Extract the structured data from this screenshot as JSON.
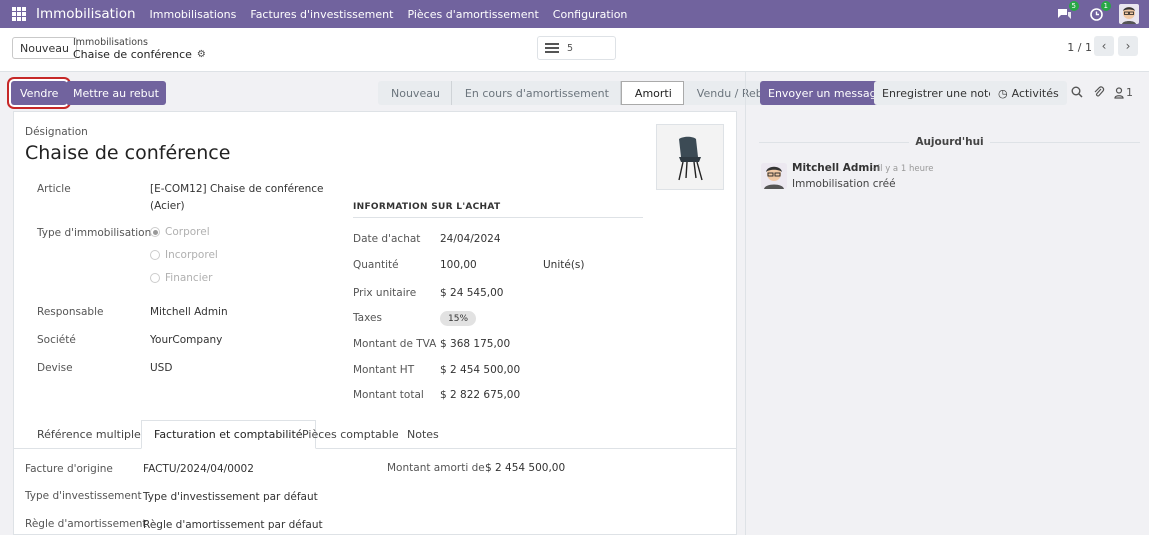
{
  "navbar": {
    "app_name": "Immobilisation",
    "menu": [
      "Immobilisations",
      "Factures d'investissement",
      "Pièces d'amortissement",
      "Configuration"
    ],
    "messages_badge": "5",
    "activities_badge": "1"
  },
  "control": {
    "new_label": "Nouveau",
    "breadcrumb_parent": "Immobilisations",
    "breadcrumb_current": "Chaise de conférence",
    "count": "5",
    "pager": "1 / 1"
  },
  "actions": {
    "sell": "Vendre",
    "scrap": "Mettre au rebut"
  },
  "status": {
    "stages": [
      "Nouveau",
      "En cours d'amortissement",
      "Amorti",
      "Vendu / Rebut"
    ],
    "active": "Amorti"
  },
  "form": {
    "name_label": "Désignation",
    "name": "Chaise de conférence",
    "article_label": "Article",
    "article_line1": "[E-COM12] Chaise de conférence",
    "article_line2": "(Acier)",
    "type_label": "Type d'immobilisation",
    "type_options": [
      "Corporel",
      "Incorporel",
      "Financier"
    ],
    "type_selected": "Corporel",
    "responsible_label": "Responsable",
    "responsible": "Mitchell Admin",
    "company_label": "Société",
    "company": "YourCompany",
    "currency_label": "Devise",
    "currency": "USD",
    "purchase_section": "INFORMATION SUR L'ACHAT",
    "purchase": {
      "date_label": "Date d'achat",
      "date": "24/04/2024",
      "qty_label": "Quantité",
      "qty": "100,00",
      "uom": "Unité(s)",
      "unit_price_label": "Prix unitaire",
      "unit_price": "$ 24 545,00",
      "taxes_label": "Taxes",
      "taxes": "15%",
      "vat_label": "Montant de TVA",
      "vat": "$ 368 175,00",
      "untaxed_label": "Montant HT",
      "untaxed": "$ 2 454 500,00",
      "total_label": "Montant total",
      "total": "$ 2 822 675,00"
    },
    "tabs": [
      "Référence multiples",
      "Facturation et comptabilité",
      "Pièces comptable",
      "Notes"
    ],
    "active_tab": "Facturation et comptabilité",
    "billing": {
      "origin_label": "Facture d'origine",
      "origin": "FACTU/2024/04/0002",
      "depreciated_label": "Montant amorti de",
      "depreciated": "$ 2 454 500,00",
      "inv_type_label": "Type d'investissement",
      "inv_type": "Type d'investissement par défaut",
      "dep_rule_label": "Règle d'amortissement",
      "dep_rule": "Règle d'amortissement par défaut"
    }
  },
  "chatter": {
    "send_message": "Envoyer un message",
    "log_note": "Enregistrer une note",
    "activities": "Activités",
    "followers": "1",
    "today": "Aujourd'hui",
    "message": {
      "author": "Mitchell Admin",
      "time": "- il y a 1 heure",
      "body": "Immobilisation créé"
    }
  },
  "colors": {
    "brand": "#71639e",
    "highlight": "#c62828"
  }
}
